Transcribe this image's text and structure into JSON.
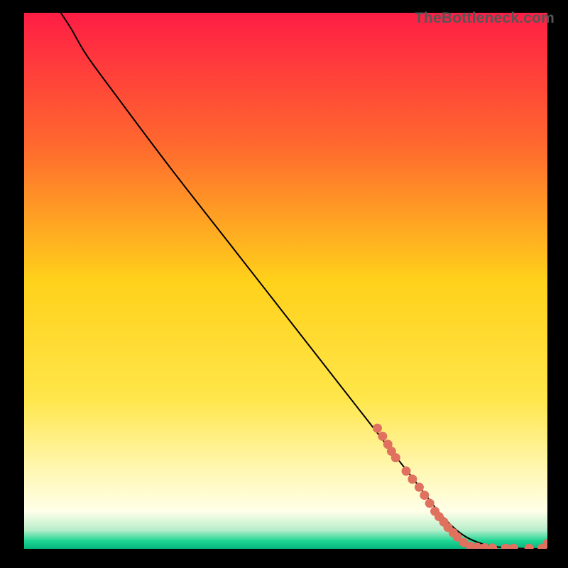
{
  "watermark": "TheBottleneck.com",
  "chart_data": {
    "type": "line",
    "title": "",
    "xlabel": "",
    "ylabel": "",
    "xlim": [
      0,
      100
    ],
    "ylim": [
      0,
      100
    ],
    "grid": false,
    "background_gradient": {
      "stops": [
        {
          "offset": 0.0,
          "color": "#ff1d45"
        },
        {
          "offset": 0.25,
          "color": "#ff6a2e"
        },
        {
          "offset": 0.5,
          "color": "#ffd11a"
        },
        {
          "offset": 0.72,
          "color": "#ffe64a"
        },
        {
          "offset": 0.85,
          "color": "#fff7b0"
        },
        {
          "offset": 0.93,
          "color": "#ffffe8"
        },
        {
          "offset": 0.965,
          "color": "#b8eecb"
        },
        {
          "offset": 0.985,
          "color": "#1fd693"
        },
        {
          "offset": 1.0,
          "color": "#04b57e"
        }
      ]
    },
    "series": [
      {
        "name": "bottleneck-curve",
        "color": "#000000",
        "x": [
          7,
          9,
          12,
          18,
          28,
          40,
          50,
          60,
          70,
          76,
          80,
          84,
          88,
          92,
          96,
          100
        ],
        "y": [
          100,
          97,
          92,
          84,
          71,
          56,
          43.5,
          31,
          18.5,
          11,
          6,
          2.5,
          0.8,
          0.2,
          0.05,
          0
        ]
      }
    ],
    "bead_points": {
      "name": "data-beads",
      "color": "#e0715f",
      "radius": 6.5,
      "points": [
        {
          "x": 67.5,
          "y": 22.5
        },
        {
          "x": 68.5,
          "y": 21.0
        },
        {
          "x": 69.5,
          "y": 19.5
        },
        {
          "x": 70.2,
          "y": 18.2
        },
        {
          "x": 71.0,
          "y": 17.0
        },
        {
          "x": 73.0,
          "y": 14.5
        },
        {
          "x": 74.2,
          "y": 13.0
        },
        {
          "x": 75.5,
          "y": 11.5
        },
        {
          "x": 76.5,
          "y": 10.0
        },
        {
          "x": 77.5,
          "y": 8.5
        },
        {
          "x": 78.5,
          "y": 7.0
        },
        {
          "x": 79.3,
          "y": 6.0
        },
        {
          "x": 80.2,
          "y": 5.0
        },
        {
          "x": 81.0,
          "y": 4.0
        },
        {
          "x": 82.0,
          "y": 3.0
        },
        {
          "x": 82.8,
          "y": 2.2
        },
        {
          "x": 84.0,
          "y": 1.2
        },
        {
          "x": 85.3,
          "y": 0.5
        },
        {
          "x": 86.6,
          "y": 0.3
        },
        {
          "x": 88.0,
          "y": 0.2
        },
        {
          "x": 89.5,
          "y": 0.15
        },
        {
          "x": 92.0,
          "y": 0.1
        },
        {
          "x": 93.5,
          "y": 0.1
        },
        {
          "x": 96.5,
          "y": 0.1
        },
        {
          "x": 99.0,
          "y": 0.1
        },
        {
          "x": 100.0,
          "y": 1.0
        }
      ]
    }
  }
}
